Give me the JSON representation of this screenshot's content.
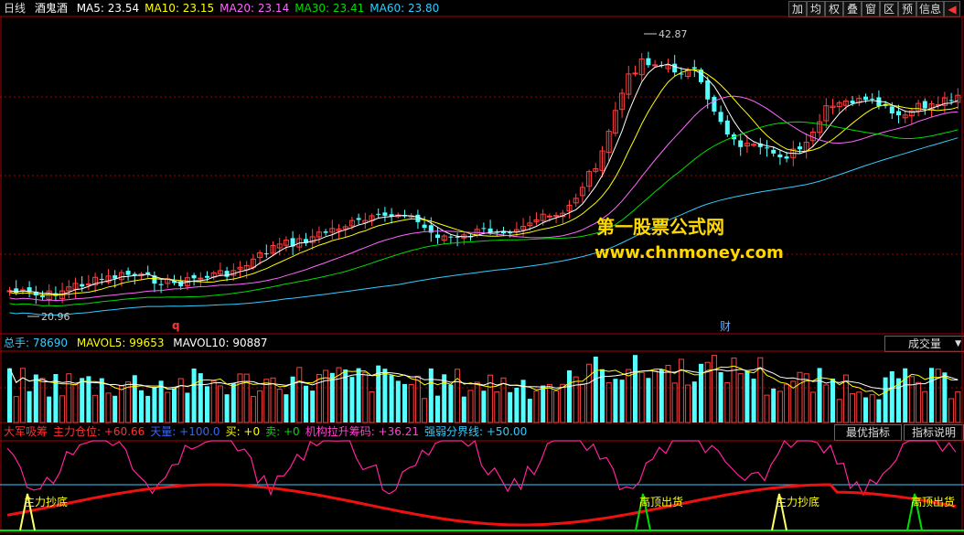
{
  "top": {
    "period": "日线",
    "stock_name": "酒鬼酒",
    "ma": [
      {
        "text": "MA5: 23.54",
        "color": "#ffffff"
      },
      {
        "text": "MA10: 23.15",
        "color": "#ffff00"
      },
      {
        "text": "MA20: 23.14",
        "color": "#ff66ff"
      },
      {
        "text": "MA30: 23.41",
        "color": "#00dd00"
      },
      {
        "text": "MA60: 23.80",
        "color": "#33ccff"
      }
    ],
    "tools": [
      "加",
      "均",
      "权",
      "叠",
      "窗",
      "区",
      "预",
      "信息",
      "◀"
    ]
  },
  "price_chart": {
    "high_label": "42.87",
    "low_label": "20.96",
    "q_marker": "q",
    "cai_marker": "财"
  },
  "watermark": {
    "line1": "第一股票公式网",
    "line2": "www.chnmoney.com"
  },
  "volume": {
    "label_main": "总手: 78690",
    "label_ma5": "MAVOL5: 99653",
    "label_ma10": "MAVOL10: 90887",
    "select_value": "成交量",
    "arrow": "▼"
  },
  "indicator": {
    "items": [
      {
        "text": "大军吸筹",
        "color": "#ff3333"
      },
      {
        "text": "主力仓位: +60.66",
        "color": "#ff3333"
      },
      {
        "text": "天量: +100.0",
        "color": "#3366ff"
      },
      {
        "text": "买: +0",
        "color": "#ffff00"
      },
      {
        "text": "卖: +0",
        "color": "#00dd00"
      },
      {
        "text": "机构拉升筹码: +36.21",
        "color": "#ff44cc"
      },
      {
        "text": "强弱分界线: +50.00",
        "color": "#33ccff"
      }
    ],
    "btn_best": "最优指标",
    "btn_explain": "指标说明",
    "signals": [
      "主力抄底",
      "高顶出货",
      "主力抄底",
      "高顶出货"
    ]
  },
  "colors": {
    "up": "#ff4040",
    "down": "#54ffff",
    "grid": "#aa0000"
  }
}
